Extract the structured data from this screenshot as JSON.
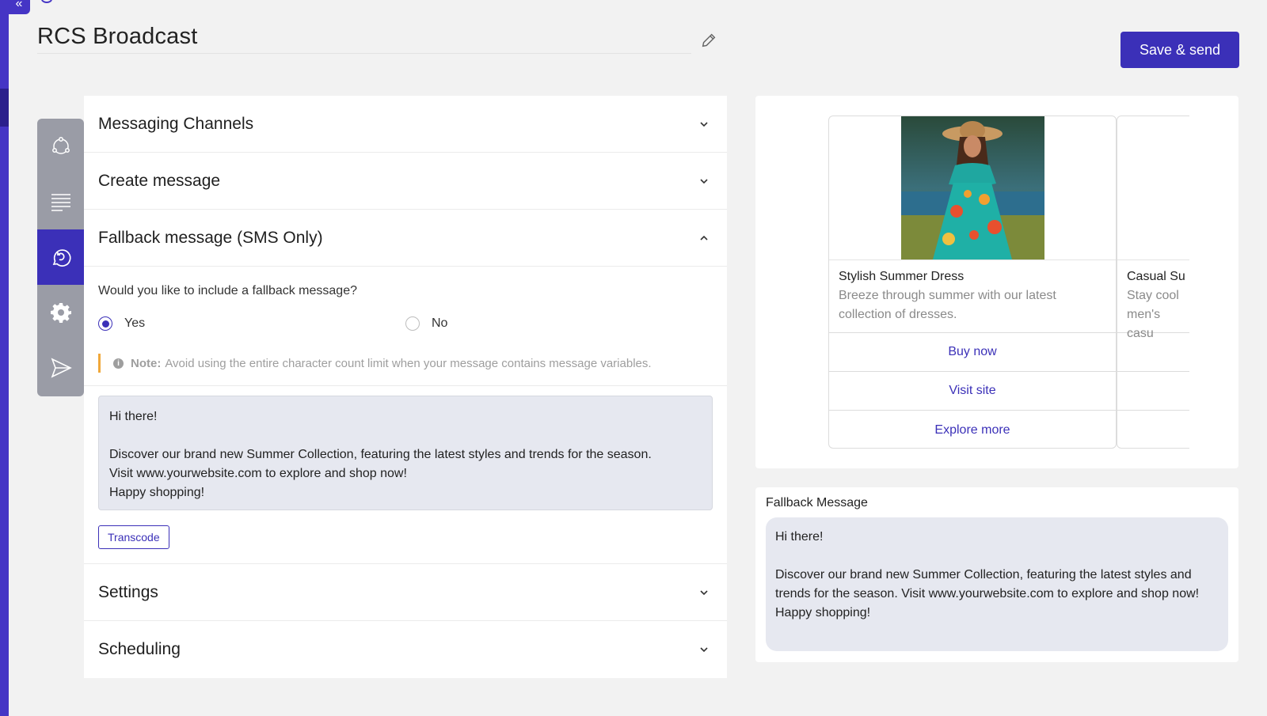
{
  "page": {
    "title": "RCS Broadcast"
  },
  "toolbar": {
    "save_send_label": "Save & send"
  },
  "steps": [
    {
      "icon": "channels-icon"
    },
    {
      "icon": "message-lines-icon"
    },
    {
      "icon": "fallback-icon",
      "active": true
    },
    {
      "icon": "gear-icon"
    },
    {
      "icon": "send-icon"
    }
  ],
  "sections": {
    "messaging_channels": "Messaging Channels",
    "create_message": "Create message",
    "fallback": "Fallback message (SMS Only)",
    "settings": "Settings",
    "scheduling": "Scheduling"
  },
  "fallback_form": {
    "question": "Would you like to include a fallback message?",
    "option_yes": "Yes",
    "option_no": "No",
    "selected": "Yes",
    "note_label": "Note:",
    "note_text": "Avoid using the entire character count limit when your message contains message variables.",
    "message": "Hi there!\n\nDiscover our brand new Summer Collection, featuring the latest styles and trends for the season.\nVisit www.yourwebsite.com to explore and shop now!\nHappy shopping!",
    "transcode_label": "Transcode"
  },
  "preview": {
    "cards": [
      {
        "title": "Stylish Summer Dress",
        "description": "Breeze through summer with our latest collection of dresses.",
        "buttons": [
          "Buy now",
          "Visit site",
          "Explore more"
        ]
      },
      {
        "title": "Casual Su",
        "description": "Stay cool   men's casu",
        "buttons": [
          "",
          "",
          ""
        ]
      }
    ],
    "fallback_title": "Fallback Message",
    "fallback_text": "Hi there!\n\nDiscover our brand new Summer Collection, featuring the latest styles and trends for the season. Visit www.yourwebsite.com to explore and shop now!\nHappy shopping!"
  },
  "colors": {
    "accent": "#3b30b8",
    "rail": "#4535c5",
    "note_bar": "#f0a83a"
  }
}
